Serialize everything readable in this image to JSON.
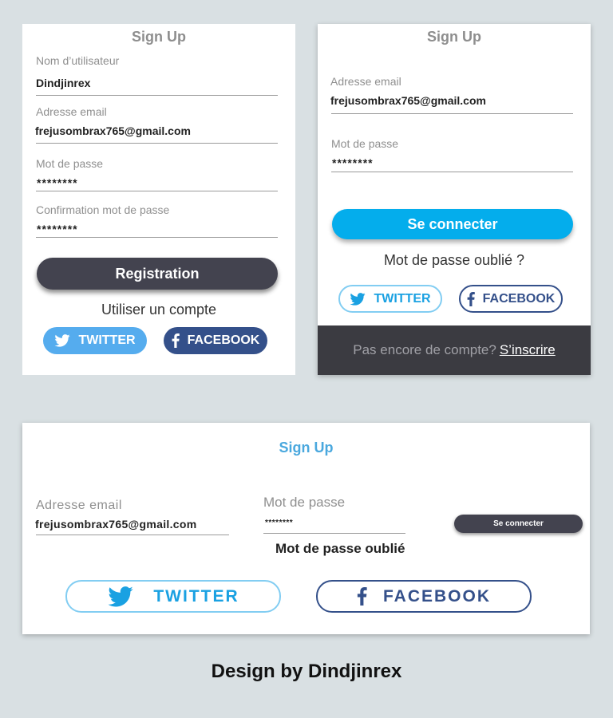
{
  "card1": {
    "title": "Sign Up",
    "username_label": "Nom d’utilisateur",
    "username_value": "Dindjinrex",
    "email_label": "Adresse email",
    "email_value": "frejusombrax765@gmail.com",
    "password_label": "Mot de passe",
    "password_value": "********",
    "confirm_label": "Confirmation mot de passe",
    "confirm_value": "********",
    "register_button": "Registration",
    "alt_text": "Utiliser un compte",
    "twitter_label": "TWITTER",
    "facebook_label": "FACEBOOK"
  },
  "card2": {
    "title": "Sign Up",
    "email_label": "Adresse email",
    "email_value": "frejusombrax765@gmail.com",
    "password_label": "Mot de passe",
    "password_value": "********",
    "login_button": "Se connecter",
    "forgot_text": "Mot de passe oublié ?",
    "twitter_label": "TWITTER",
    "facebook_label": "FACEBOOK",
    "footer_text": "Pas encore de compte?",
    "footer_link": "S’inscrire"
  },
  "card3": {
    "title": "Sign Up",
    "email_label": "Adresse email",
    "email_value": "frejusombrax765@gmail.com",
    "password_label": "Mot de passe",
    "password_value": "********",
    "login_button": "Se connecter",
    "forgot_text": "Mot de passe oublié",
    "twitter_label": "TWITTER",
    "facebook_label": "FACEBOOK"
  },
  "credit": "Design by Dindjinrex",
  "icons": [
    "twitter-icon",
    "facebook-icon"
  ],
  "colors": {
    "background": "#d9e0e3",
    "dark_button": "#43434f",
    "blue_button": "#04adec",
    "twitter": "#55acee",
    "facebook": "#34508a",
    "footer": "#3b3b41",
    "title_blue": "#4aa8de"
  }
}
